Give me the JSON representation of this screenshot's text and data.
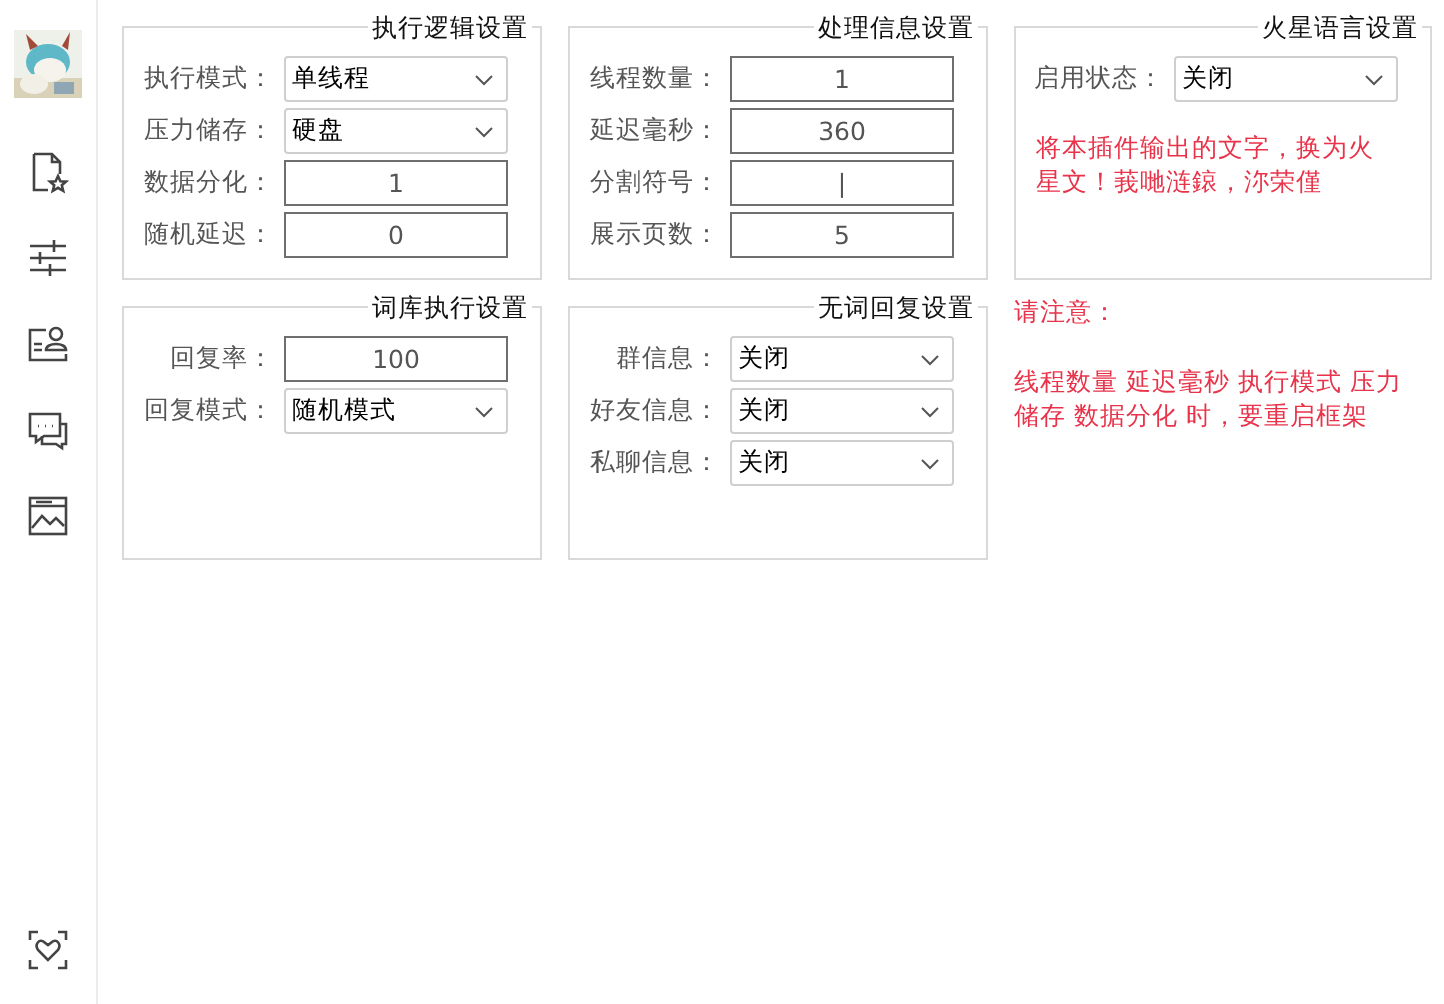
{
  "groups": [
    {
      "title": "执行逻辑设置",
      "rows": [
        {
          "kind": "select",
          "label": "执行模式：",
          "value": "单线程"
        },
        {
          "kind": "select",
          "label": "压力储存：",
          "value": "硬盘"
        },
        {
          "kind": "input",
          "label": "数据分化：",
          "value": "1"
        },
        {
          "kind": "input",
          "label": "随机延迟：",
          "value": "0"
        }
      ]
    },
    {
      "title": "处理信息设置",
      "rows": [
        {
          "kind": "input",
          "label": "线程数量：",
          "value": "1"
        },
        {
          "kind": "input",
          "label": "延迟毫秒：",
          "value": "360"
        },
        {
          "kind": "input",
          "label": "分割符号：",
          "value": "|"
        },
        {
          "kind": "input",
          "label": "展示页数：",
          "value": "5"
        }
      ]
    },
    {
      "title": "火星语言设置",
      "rows": [
        {
          "kind": "select",
          "label": "启用状态：",
          "value": "关闭"
        }
      ],
      "note": "将本插件输出的文字，换为火星文！莪哋涟鎄，沵荣僅"
    },
    {
      "title": "词库执行设置",
      "rows": [
        {
          "kind": "input",
          "label": "回复率：",
          "value": "100"
        },
        {
          "kind": "select",
          "label": "回复模式：",
          "value": "随机模式"
        }
      ]
    },
    {
      "title": "无词回复设置",
      "rows": [
        {
          "kind": "select",
          "label": "群信息：",
          "value": "关闭"
        },
        {
          "kind": "select",
          "label": "好友信息：",
          "value": "关闭"
        },
        {
          "kind": "select",
          "label": "私聊信息：",
          "value": "关闭"
        }
      ]
    }
  ],
  "notice": {
    "heading": "请注意：",
    "text": "线程数量 延迟毫秒 执行模式 压力储存 数据分化 时，要重启框架"
  }
}
